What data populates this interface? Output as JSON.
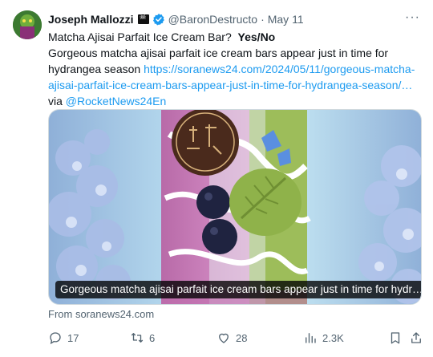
{
  "author": {
    "name": "Joseph Mallozzi",
    "handle": "@BaronDestructo",
    "separator": "·",
    "date": "May 11"
  },
  "tweet": {
    "line1_title": "Matcha Ajisai Parfait Ice Cream Bar?",
    "line1_bold": "Yes/No",
    "body": "Gorgeous matcha ajisai parfait ice cream bars appear just in time for hydrangea season",
    "link": "https://soranews24.com/2024/05/11/gorgeous-matcha-ajisai-parfait-ice-cream-bars-appear-just-in-time-for-hydrangea-season/…",
    "via": "via",
    "mention": "@RocketNews24En"
  },
  "card": {
    "caption": "Gorgeous matcha ajisai parfait ice cream bars appear just in time for hydr…",
    "source": "From soranews24.com"
  },
  "actions": {
    "replies": "17",
    "retweets": "6",
    "likes": "28",
    "views": "2.3K"
  },
  "colors": {
    "link": "#1d9bf0",
    "secondary_text": "#536471",
    "verified": "#1d9bf0"
  }
}
